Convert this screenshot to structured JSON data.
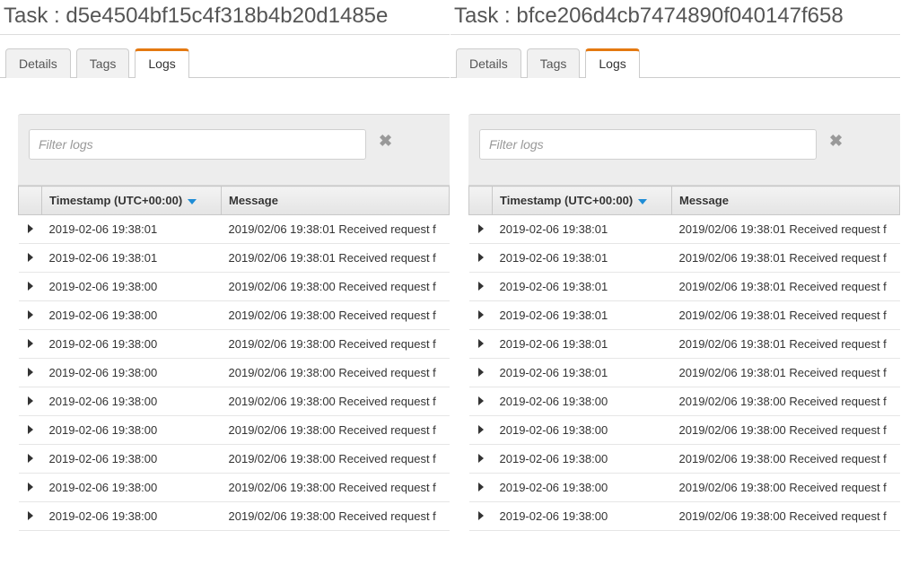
{
  "tabs": {
    "details": "Details",
    "tags": "Tags",
    "logs": "Logs"
  },
  "filter": {
    "placeholder": "Filter logs",
    "clear_glyph": "✖"
  },
  "headers": {
    "timestamp": "Timestamp (UTC+00:00)",
    "message": "Message"
  },
  "panels": [
    {
      "title": "Task : d5e4504bf15c4f318b4b20d1485e",
      "rows": [
        {
          "ts": "2019-02-06 19:38:01",
          "msg": "2019/02/06 19:38:01 Received request f"
        },
        {
          "ts": "2019-02-06 19:38:01",
          "msg": "2019/02/06 19:38:01 Received request f"
        },
        {
          "ts": "2019-02-06 19:38:00",
          "msg": "2019/02/06 19:38:00 Received request f"
        },
        {
          "ts": "2019-02-06 19:38:00",
          "msg": "2019/02/06 19:38:00 Received request f"
        },
        {
          "ts": "2019-02-06 19:38:00",
          "msg": "2019/02/06 19:38:00 Received request f"
        },
        {
          "ts": "2019-02-06 19:38:00",
          "msg": "2019/02/06 19:38:00 Received request f"
        },
        {
          "ts": "2019-02-06 19:38:00",
          "msg": "2019/02/06 19:38:00 Received request f"
        },
        {
          "ts": "2019-02-06 19:38:00",
          "msg": "2019/02/06 19:38:00 Received request f"
        },
        {
          "ts": "2019-02-06 19:38:00",
          "msg": "2019/02/06 19:38:00 Received request f"
        },
        {
          "ts": "2019-02-06 19:38:00",
          "msg": "2019/02/06 19:38:00 Received request f"
        },
        {
          "ts": "2019-02-06 19:38:00",
          "msg": "2019/02/06 19:38:00 Received request f"
        }
      ]
    },
    {
      "title": "Task : bfce206d4cb7474890f040147f658",
      "rows": [
        {
          "ts": "2019-02-06 19:38:01",
          "msg": "2019/02/06 19:38:01 Received request f"
        },
        {
          "ts": "2019-02-06 19:38:01",
          "msg": "2019/02/06 19:38:01 Received request f"
        },
        {
          "ts": "2019-02-06 19:38:01",
          "msg": "2019/02/06 19:38:01 Received request f"
        },
        {
          "ts": "2019-02-06 19:38:01",
          "msg": "2019/02/06 19:38:01 Received request f"
        },
        {
          "ts": "2019-02-06 19:38:01",
          "msg": "2019/02/06 19:38:01 Received request f"
        },
        {
          "ts": "2019-02-06 19:38:01",
          "msg": "2019/02/06 19:38:01 Received request f"
        },
        {
          "ts": "2019-02-06 19:38:00",
          "msg": "2019/02/06 19:38:00 Received request f"
        },
        {
          "ts": "2019-02-06 19:38:00",
          "msg": "2019/02/06 19:38:00 Received request f"
        },
        {
          "ts": "2019-02-06 19:38:00",
          "msg": "2019/02/06 19:38:00 Received request f"
        },
        {
          "ts": "2019-02-06 19:38:00",
          "msg": "2019/02/06 19:38:00 Received request f"
        },
        {
          "ts": "2019-02-06 19:38:00",
          "msg": "2019/02/06 19:38:00 Received request f"
        }
      ]
    }
  ]
}
